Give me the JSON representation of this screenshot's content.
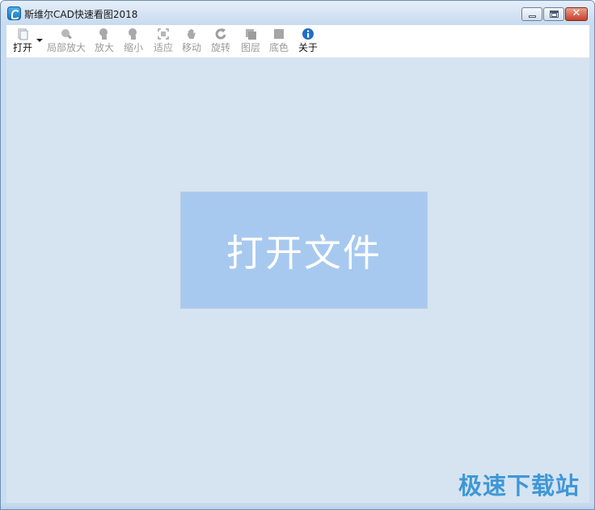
{
  "window": {
    "title": "斯维尔CAD快速看图2018"
  },
  "caption": {
    "minimize_icon": "minimize-icon",
    "maximize_icon": "maximize-icon",
    "close_label": "✕"
  },
  "toolbar": {
    "items": [
      {
        "id": "open",
        "label": "打开",
        "icon": "open-file-icon",
        "enabled": true
      },
      {
        "id": "partial-zoom",
        "label": "局部放大",
        "icon": "zoom-window-icon",
        "enabled": false
      },
      {
        "id": "zoom-in",
        "label": "放大",
        "icon": "zoom-in-icon",
        "enabled": false
      },
      {
        "id": "zoom-out",
        "label": "缩小",
        "icon": "zoom-out-icon",
        "enabled": false
      },
      {
        "id": "fit",
        "label": "适应",
        "icon": "fit-icon",
        "enabled": false
      },
      {
        "id": "move",
        "label": "移动",
        "icon": "pan-hand-icon",
        "enabled": false
      },
      {
        "id": "rotate",
        "label": "旋转",
        "icon": "rotate-icon",
        "enabled": false
      },
      {
        "id": "layers",
        "label": "图层",
        "icon": "layers-icon",
        "enabled": false
      },
      {
        "id": "background",
        "label": "底色",
        "icon": "background-color-icon",
        "enabled": false
      },
      {
        "id": "about",
        "label": "关于",
        "icon": "info-icon",
        "enabled": true
      }
    ]
  },
  "main": {
    "open_file_label": "打开文件"
  },
  "watermark": {
    "text": "极速下载站"
  },
  "colors": {
    "canvas": "#d6e4f1",
    "open_button": "#a8c9ef",
    "info_blue": "#1f6fc4",
    "watermark": "#3f97d6"
  }
}
